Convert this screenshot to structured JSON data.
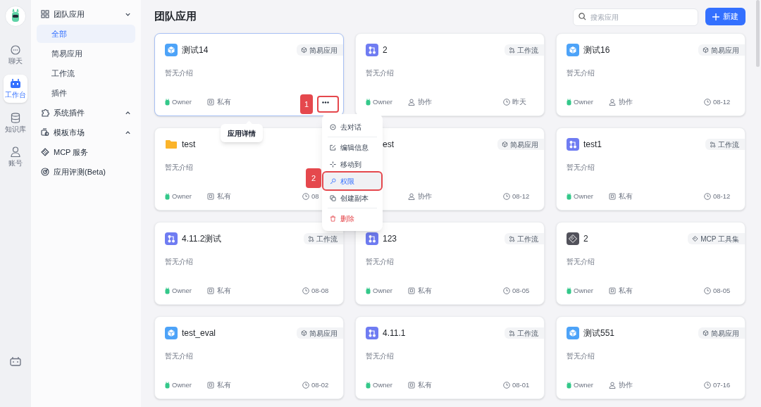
{
  "rail": {
    "items": [
      {
        "kind": "chat",
        "label": "聊天",
        "selected": false
      },
      {
        "kind": "robot",
        "label": "工作台",
        "selected": true
      },
      {
        "kind": "database",
        "label": "知识库",
        "selected": false
      },
      {
        "kind": "person",
        "label": "账号",
        "selected": false
      }
    ]
  },
  "nav": {
    "groups": [
      {
        "kind": "grid",
        "label": "团队应用",
        "expanded": true,
        "children": [
          {
            "label": "全部",
            "selected": true
          },
          {
            "label": "简易应用",
            "selected": false
          },
          {
            "label": "工作流",
            "selected": false
          },
          {
            "label": "插件",
            "selected": false
          }
        ]
      },
      {
        "kind": "puzzle",
        "label": "系统插件",
        "expanded": false
      },
      {
        "kind": "market",
        "label": "模板市场",
        "expanded": false
      },
      {
        "kind": "mcp",
        "label": "MCP 服务"
      },
      {
        "kind": "target",
        "label": "应用评测(Beta)"
      }
    ]
  },
  "header": {
    "title": "团队应用",
    "search": {
      "placeholder": "搜索应用"
    },
    "new_button": "新建"
  },
  "cards": [
    {
      "kind": "simple",
      "title": "测试14",
      "tag": "简易应用",
      "description": "暂无介绍",
      "owner": "Owner",
      "private": true,
      "access_label": "私有",
      "selected": true,
      "more_button": true
    },
    {
      "kind": "workflow",
      "title": "2",
      "tag": "工作流",
      "description": "暂无介绍",
      "owner": "Owner",
      "private": false,
      "access_label": "协作",
      "date": "昨天",
      "selected": false
    },
    {
      "kind": "simple",
      "title": "测试16",
      "tag": "简易应用",
      "description": "暂无介绍",
      "owner": "Owner",
      "private": false,
      "access_label": "协作",
      "date": "08-12",
      "selected": false
    },
    {
      "kind": "folder",
      "title": "test",
      "description": "暂无介绍",
      "owner": "Owner",
      "private": true,
      "access_label": "私有",
      "date": "08",
      "selected": false
    },
    {
      "kind": "simple",
      "title": "est",
      "tag": "简易应用",
      "private": false,
      "access_label": "协作",
      "date": "08-12",
      "selected": false
    },
    {
      "kind": "workflow",
      "title": "test1",
      "tag": "工作流",
      "description": "暂无介绍",
      "owner": "Owner",
      "private": true,
      "access_label": "私有",
      "date": "08-12",
      "selected": false
    },
    {
      "kind": "workflow",
      "title": "4.11.2测试",
      "tag": "工作流",
      "description": "暂无介绍",
      "owner": "Owner",
      "private": true,
      "access_label": "私有",
      "date": "08-08",
      "selected": false
    },
    {
      "kind": "workflow",
      "title": "123",
      "tag": "工作流",
      "description": "暂无介绍",
      "owner": "Owner",
      "private": true,
      "access_label": "私有",
      "date": "08-05",
      "selected": false
    },
    {
      "kind": "mcp",
      "title": "2",
      "tag": "MCP 工具集",
      "description": "暂无介绍",
      "owner": "Owner",
      "private": true,
      "access_label": "私有",
      "date": "08-05",
      "selected": false
    },
    {
      "kind": "simple",
      "title": "test_eval",
      "tag": "简易应用",
      "description": "暂无介绍",
      "owner": "Owner",
      "private": true,
      "access_label": "私有",
      "date": "08-02",
      "selected": false
    },
    {
      "kind": "workflow",
      "title": "4.11.1",
      "tag": "工作流",
      "description": "暂无介绍",
      "owner": "Owner",
      "private": true,
      "access_label": "私有",
      "date": "08-01",
      "selected": false
    },
    {
      "kind": "simple",
      "title": "测试551",
      "tag": "简易应用",
      "description": "暂无介绍",
      "owner": "Owner",
      "private": false,
      "access_label": "协作",
      "date": "07-16",
      "selected": false
    }
  ],
  "tooltip": "应用详情",
  "context_menu": [
    {
      "kind": "chat",
      "label": "去对话",
      "highlighted": false,
      "divider_after": true
    },
    {
      "kind": "edit",
      "label": "编辑信息",
      "highlighted": false,
      "divider_after": false
    },
    {
      "kind": "move",
      "label": "移动到",
      "highlighted": false,
      "divider_after": false
    },
    {
      "kind": "key",
      "label": "权限",
      "highlighted": true,
      "divider_after": false
    },
    {
      "kind": "copy",
      "label": "创建副本",
      "highlighted": false,
      "divider_after": true
    },
    {
      "kind": "delete",
      "label": "删除",
      "highlighted": false,
      "divider_after": false
    }
  ],
  "annotations": [
    {
      "label": "1"
    },
    {
      "label": "2"
    }
  ]
}
